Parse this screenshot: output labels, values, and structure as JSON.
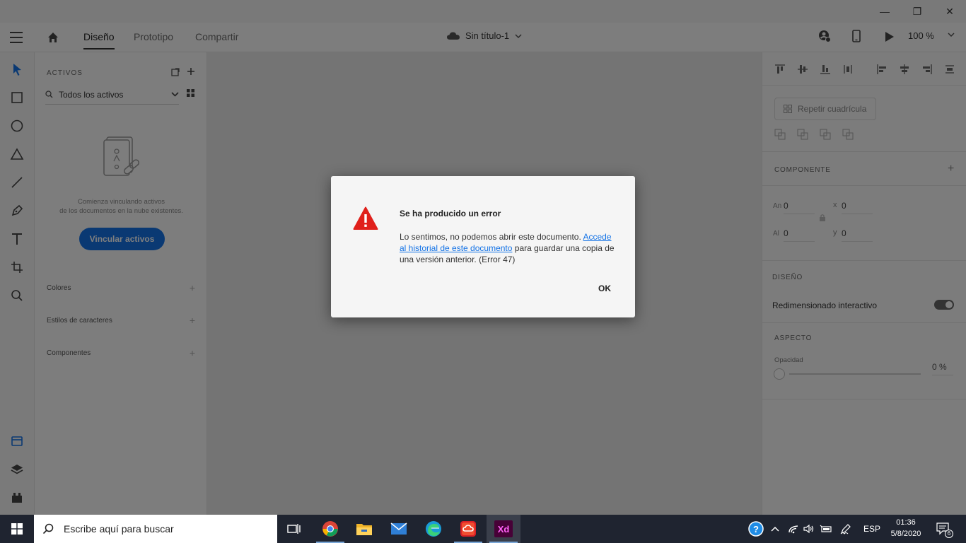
{
  "window": {
    "minimize": "—",
    "restore": "❐",
    "close": "✕"
  },
  "menubar": {
    "tabs": [
      {
        "label": "Diseño",
        "active": true
      },
      {
        "label": "Prototipo",
        "active": false
      },
      {
        "label": "Compartir",
        "active": false
      }
    ],
    "document_title": "Sin título-1",
    "zoom": "100 %"
  },
  "assets_panel": {
    "heading": "ACTIVOS",
    "filter": "Todos los activos",
    "empty_message_1": "Comienza vinculando activos",
    "empty_message_2": "de los documentos en la nube existentes.",
    "link_button": "Vincular activos",
    "sections": [
      "Colores",
      "Estilos de caracteres",
      "Componentes"
    ]
  },
  "properties_panel": {
    "repeat_grid": "Repetir cuadrícula",
    "component_heading": "COMPONENTE",
    "width_label": "An",
    "width_value": "0",
    "height_label": "Al",
    "height_value": "0",
    "x_label": "x",
    "x_value": "0",
    "y_label": "y",
    "y_value": "0",
    "design_heading": "DISEÑO",
    "responsive_resize": "Redimensionado interactivo",
    "responsive_resize_on": true,
    "appearance_heading": "ASPECTO",
    "opacity_label": "Opacidad",
    "opacity_value": "0 %"
  },
  "dialog": {
    "title": "Se ha producido un error",
    "message_before": "Lo sentimos, no podemos abrir este documento. ",
    "message_link": "Accede al historial de este documento",
    "message_after": " para guardar una copia de una versión anterior. (Error 47)",
    "ok_label": "OK",
    "icon": "warning-icon"
  },
  "taskbar": {
    "search_placeholder": "Escribe aquí para buscar",
    "apps": [
      "task-view",
      "chrome",
      "file-explorer",
      "mail",
      "edge",
      "creative-cloud",
      "adobe-xd"
    ],
    "language": "ESP",
    "time": "01:36",
    "date": "5/8/2020",
    "notifications": "6"
  },
  "colors": {
    "accent": "#1473e6",
    "xd_brand": "#470137",
    "xd_text": "#ff61f6",
    "error_red": "#e0201b"
  }
}
